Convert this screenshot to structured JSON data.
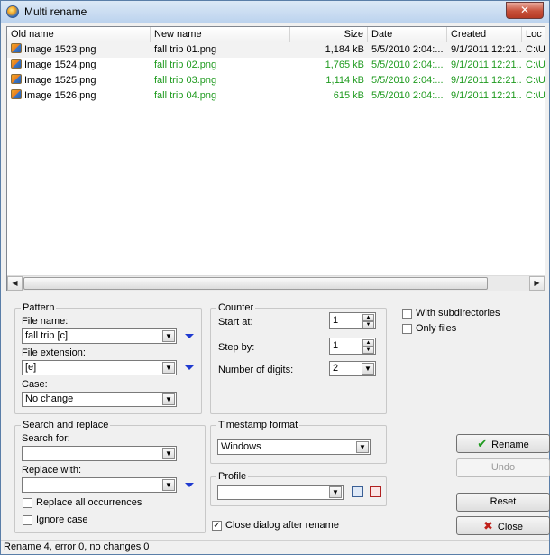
{
  "window": {
    "title": "Multi rename"
  },
  "columns": {
    "old_name": "Old name",
    "new_name": "New name",
    "size": "Size",
    "date": "Date",
    "created": "Created",
    "location": "Loc"
  },
  "files": [
    {
      "old": "Image 1523.png",
      "new": "fall trip 01.png",
      "size": "1,184 kB",
      "date": "5/5/2010 2:04:...",
      "created": "9/1/2011 12:21...",
      "loc": "C:\\U"
    },
    {
      "old": "Image 1524.png",
      "new": "fall trip 02.png",
      "size": "1,765 kB",
      "date": "5/5/2010 2:04:...",
      "created": "9/1/2011 12:21...",
      "loc": "C:\\U"
    },
    {
      "old": "Image 1525.png",
      "new": "fall trip 03.png",
      "size": "1,114 kB",
      "date": "5/5/2010 2:04:...",
      "created": "9/1/2011 12:21...",
      "loc": "C:\\U"
    },
    {
      "old": "Image 1526.png",
      "new": "fall trip 04.png",
      "size": "615 kB",
      "date": "5/5/2010 2:04:...",
      "created": "9/1/2011 12:21...",
      "loc": "C:\\U"
    }
  ],
  "pattern": {
    "label": "Pattern",
    "file_name_label": "File name:",
    "file_name_value": "fall trip [c]",
    "file_ext_label": "File extension:",
    "file_ext_value": "[e]",
    "case_label": "Case:",
    "case_value": "No change"
  },
  "counter": {
    "label": "Counter",
    "start_label": "Start at:",
    "start_value": "1",
    "step_label": "Step by:",
    "step_value": "1",
    "digits_label": "Number of digits:",
    "digits_value": "2"
  },
  "options": {
    "with_subdirs": "With subdirectories",
    "only_files": "Only files"
  },
  "search_replace": {
    "label": "Search and replace",
    "search_label": "Search for:",
    "search_value": "",
    "replace_label": "Replace with:",
    "replace_value": "",
    "replace_all": "Replace all occurrences",
    "ignore_case": "Ignore case"
  },
  "timestamp": {
    "label": "Timestamp format",
    "value": "Windows"
  },
  "profile": {
    "label": "Profile",
    "value": ""
  },
  "close_after": {
    "label": "Close dialog after rename",
    "checked": true
  },
  "buttons": {
    "rename": "Rename",
    "undo": "Undo",
    "reset": "Reset",
    "close": "Close"
  },
  "status": "Rename 4, error 0, no changes 0",
  "colors": {
    "new_name_text": "#1e9a1e",
    "selected_row": "#f2f2f2"
  }
}
